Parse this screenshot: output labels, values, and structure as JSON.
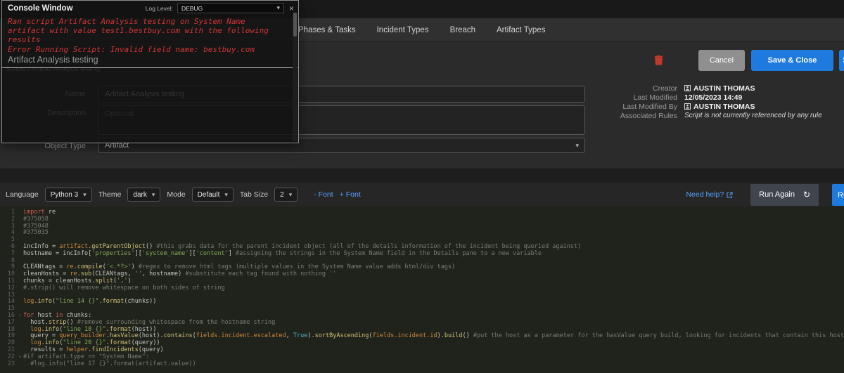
{
  "colors": {
    "accent_blue": "#1f7ae0",
    "danger_red": "#c0392b",
    "log_red": "#d03535",
    "editor_bg": "#20231c"
  },
  "icons": {
    "close": "×",
    "chevron": "▾",
    "refresh": "↻"
  },
  "console": {
    "title": "Console Window",
    "log_level_label": "Log Level:",
    "log_level_value": "DEBUG",
    "messages": [
      "Ran script Artifact Analysis testing on System Name artifact with value test1.bestbuy.com with the following results",
      "Error Running Script: Invalid field name: bestbuy.com"
    ],
    "entry_title": "Artifact Analysis testing"
  },
  "nav": {
    "tabs": [
      {
        "label": "Phases & Tasks"
      },
      {
        "label": "Incident Types"
      },
      {
        "label": "Breach"
      },
      {
        "label": "Artifact Types"
      }
    ]
  },
  "breadcrumb": "Scripts / Artifact Analysis testing",
  "actions": {
    "cancel_label": "Cancel",
    "save_close_label": "Save & Close",
    "partial_label": "S"
  },
  "form": {
    "name_label": "Name",
    "name_value": "Artifact Analysis testing",
    "description_label": "Description",
    "description_placeholder": "Optional",
    "object_type_label": "Object Type",
    "object_type_value": "Artifact"
  },
  "meta": {
    "creator_label": "Creator",
    "creator_value": "AUSTIN THOMAS",
    "last_modified_label": "Last Modified",
    "last_modified_value": "12/05/2023 14:49",
    "last_modified_by_label": "Last Modified By",
    "last_modified_by_value": "AUSTIN THOMAS",
    "associated_rules_label": "Associated Rules",
    "associated_rules_value": "Script is not currently referenced by any rule"
  },
  "toolbar": {
    "language_label": "Language",
    "language_value": "Python 3",
    "theme_label": "Theme",
    "theme_value": "dark",
    "mode_label": "Mode",
    "mode_value": "Default",
    "tab_size_label": "Tab Size",
    "tab_size_value": "2",
    "font_minus": "- Font",
    "font_plus": "+ Font",
    "need_help": "Need help?",
    "run_again": "Run Again",
    "partial_label": "Ru"
  },
  "editor": {
    "fold_marker": "-",
    "fold_lines": [
      16,
      22
    ],
    "lines": [
      [
        [
          "kw",
          "import"
        ],
        [
          "pl",
          " re"
        ]
      ],
      [
        [
          "com",
          "#375058"
        ]
      ],
      [
        [
          "com",
          "#375048"
        ]
      ],
      [
        [
          "com",
          "#375035"
        ]
      ],
      [],
      [
        [
          "pl",
          "incInfo = "
        ],
        [
          "var",
          "artifact"
        ],
        [
          "pl",
          "."
        ],
        [
          "fn",
          "getParentObject"
        ],
        [
          "pl",
          "() "
        ],
        [
          "com",
          "#this grabs data for the parent incident object (all of the details information of the incident being queried against)"
        ]
      ],
      [
        [
          "pl",
          "hostname = incInfo["
        ],
        [
          "str",
          "'properties'"
        ],
        [
          "pl",
          "]["
        ],
        [
          "str",
          "'system_name'"
        ],
        [
          "pl",
          "]["
        ],
        [
          "str",
          "'content'"
        ],
        [
          "pl",
          "] "
        ],
        [
          "com",
          "#assigning the strings in the System Name field in the Details pane to a new variable"
        ]
      ],
      [],
      [
        [
          "pl",
          "CLEANtags = "
        ],
        [
          "var",
          "re"
        ],
        [
          "pl",
          "."
        ],
        [
          "fn",
          "compile"
        ],
        [
          "pl",
          "("
        ],
        [
          "str",
          "'<.*?>'"
        ],
        [
          "pl",
          ") "
        ],
        [
          "com",
          "#regex to remove html tags (multiple values in the System Name value adds html/div tags)"
        ]
      ],
      [
        [
          "pl",
          "cleanHosts = "
        ],
        [
          "var",
          "re"
        ],
        [
          "pl",
          "."
        ],
        [
          "fn",
          "sub"
        ],
        [
          "pl",
          "(CLEANtags, "
        ],
        [
          "str",
          "''"
        ],
        [
          "pl",
          ", hostname) "
        ],
        [
          "com",
          "#substitute each tag found with nothing ''"
        ]
      ],
      [
        [
          "pl",
          "chunks = cleanHosts."
        ],
        [
          "fn",
          "split"
        ],
        [
          "pl",
          "("
        ],
        [
          "str",
          "','"
        ],
        [
          "pl",
          ")"
        ]
      ],
      [
        [
          "com",
          "#.strip() will remove whitespace on both sides of string"
        ]
      ],
      [],
      [
        [
          "var",
          "log"
        ],
        [
          "pl",
          "."
        ],
        [
          "fn",
          "info"
        ],
        [
          "pl",
          "("
        ],
        [
          "str",
          "\"line 14 {}\""
        ],
        [
          "pl",
          "."
        ],
        [
          "fn",
          "format"
        ],
        [
          "pl",
          "(chunks))"
        ]
      ],
      [],
      [
        [
          "kw",
          "for"
        ],
        [
          "pl",
          " host "
        ],
        [
          "kw",
          "in"
        ],
        [
          "pl",
          " chunks:"
        ]
      ],
      [
        [
          "pl",
          "  host."
        ],
        [
          "fn",
          "strip"
        ],
        [
          "pl",
          "() "
        ],
        [
          "com",
          "#remove surrounding whitespace from the hostname string"
        ]
      ],
      [
        [
          "pl",
          "  "
        ],
        [
          "var",
          "log"
        ],
        [
          "pl",
          "."
        ],
        [
          "fn",
          "info"
        ],
        [
          "pl",
          "("
        ],
        [
          "str",
          "\"line 18 {}\""
        ],
        [
          "pl",
          "."
        ],
        [
          "fn",
          "format"
        ],
        [
          "pl",
          "(host))"
        ]
      ],
      [
        [
          "pl",
          "  query = "
        ],
        [
          "var",
          "query_builder"
        ],
        [
          "pl",
          "."
        ],
        [
          "fn",
          "hasValue"
        ],
        [
          "pl",
          "(host)."
        ],
        [
          "fn",
          "contains"
        ],
        [
          "pl",
          "("
        ],
        [
          "var",
          "fields.incident.escalated"
        ],
        [
          "pl",
          ", "
        ],
        [
          "atom",
          "True"
        ],
        [
          "pl",
          ")."
        ],
        [
          "fn",
          "sortByAscending"
        ],
        [
          "pl",
          "("
        ],
        [
          "var",
          "fields.incident.id"
        ],
        [
          "pl",
          ")."
        ],
        [
          "fn",
          "build"
        ],
        [
          "pl",
          "() "
        ],
        [
          "com",
          "#put the host as a parameter for the hasValue query build, looking for incidents that contain this host"
        ]
      ],
      [
        [
          "pl",
          "  "
        ],
        [
          "var",
          "log"
        ],
        [
          "pl",
          "."
        ],
        [
          "fn",
          "info"
        ],
        [
          "pl",
          "("
        ],
        [
          "str",
          "\"line 20 {}\""
        ],
        [
          "pl",
          "."
        ],
        [
          "fn",
          "format"
        ],
        [
          "pl",
          "(query))"
        ]
      ],
      [
        [
          "pl",
          "  results = "
        ],
        [
          "var",
          "helper"
        ],
        [
          "pl",
          "."
        ],
        [
          "fn",
          "findIncidents"
        ],
        [
          "pl",
          "(query)"
        ]
      ],
      [
        [
          "com",
          "#if artifact.type == \"System Name\":"
        ]
      ],
      [
        [
          "pl",
          "  "
        ],
        [
          "com",
          "#log.info(\"line 17 {}\".format(artifact.value))"
        ]
      ]
    ]
  }
}
